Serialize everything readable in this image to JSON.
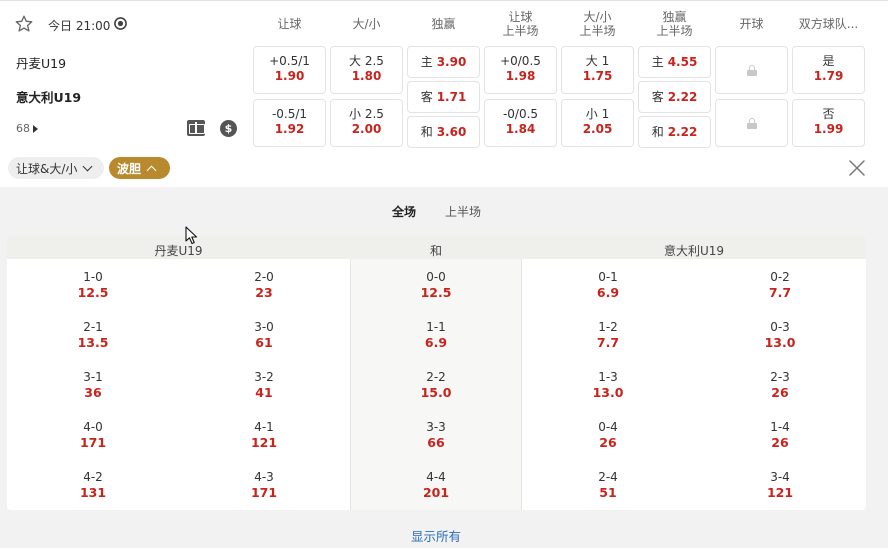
{
  "match": {
    "time_label": "今日 21:00",
    "home": "丹麦U19",
    "away": "意大利U19",
    "more_count": "68"
  },
  "columns": [
    {
      "h1": "让球",
      "h2": ""
    },
    {
      "h1": "大/小",
      "h2": ""
    },
    {
      "h1": "独赢",
      "h2": ""
    },
    {
      "h1": "让球",
      "h2": "上半场"
    },
    {
      "h1": "大/小",
      "h2": "上半场"
    },
    {
      "h1": "独赢",
      "h2": "上半场"
    },
    {
      "h1": "开球",
      "h2": ""
    },
    {
      "h1": "双方球队...",
      "h2": ""
    }
  ],
  "markets": {
    "handicap": [
      {
        "label": "+0.5/1",
        "odds": "1.90"
      },
      {
        "label": "-0.5/1",
        "odds": "1.92"
      }
    ],
    "over_under": [
      {
        "label": "大 2.5",
        "odds": "1.80"
      },
      {
        "label": "小 2.5",
        "odds": "2.00"
      }
    ],
    "win": [
      {
        "label": "主",
        "odds": "3.90"
      },
      {
        "label": "客",
        "odds": "1.71"
      },
      {
        "label": "和",
        "odds": "3.60"
      }
    ],
    "handicap_1h": [
      {
        "label": "+0/0.5",
        "odds": "1.98"
      },
      {
        "label": "-0/0.5",
        "odds": "1.84"
      }
    ],
    "over_under_1h": [
      {
        "label": "大 1",
        "odds": "1.75"
      },
      {
        "label": "小 1",
        "odds": "2.05"
      }
    ],
    "win_1h": [
      {
        "label": "主",
        "odds": "4.55"
      },
      {
        "label": "客",
        "odds": "2.22"
      },
      {
        "label": "和",
        "odds": "2.22"
      }
    ],
    "btts": [
      {
        "label": "是",
        "odds": "1.79"
      },
      {
        "label": "否",
        "odds": "1.99"
      }
    ]
  },
  "chips": {
    "filter": "让球&大/小",
    "active": "波胆"
  },
  "subtabs": [
    "全场",
    "上半场"
  ],
  "correct_score": {
    "headers": {
      "home": "丹麦U19",
      "draw": "和",
      "away": "意大利U19"
    },
    "home_a": [
      {
        "score": "1-0",
        "odds": "12.5"
      },
      {
        "score": "2-1",
        "odds": "13.5"
      },
      {
        "score": "3-1",
        "odds": "36"
      },
      {
        "score": "4-0",
        "odds": "171"
      },
      {
        "score": "4-2",
        "odds": "131"
      }
    ],
    "home_b": [
      {
        "score": "2-0",
        "odds": "23"
      },
      {
        "score": "3-0",
        "odds": "61"
      },
      {
        "score": "3-2",
        "odds": "41"
      },
      {
        "score": "4-1",
        "odds": "121"
      },
      {
        "score": "4-3",
        "odds": "171"
      }
    ],
    "draw": [
      {
        "score": "0-0",
        "odds": "12.5"
      },
      {
        "score": "1-1",
        "odds": "6.9"
      },
      {
        "score": "2-2",
        "odds": "15.0"
      },
      {
        "score": "3-3",
        "odds": "66"
      },
      {
        "score": "4-4",
        "odds": "201"
      }
    ],
    "away_a": [
      {
        "score": "0-1",
        "odds": "6.9"
      },
      {
        "score": "1-2",
        "odds": "7.7"
      },
      {
        "score": "1-3",
        "odds": "13.0"
      },
      {
        "score": "0-4",
        "odds": "26"
      },
      {
        "score": "2-4",
        "odds": "51"
      }
    ],
    "away_b": [
      {
        "score": "0-2",
        "odds": "7.7"
      },
      {
        "score": "0-3",
        "odds": "13.0"
      },
      {
        "score": "2-3",
        "odds": "26"
      },
      {
        "score": "1-4",
        "odds": "26"
      },
      {
        "score": "3-4",
        "odds": "121"
      }
    ]
  },
  "show_all": "显示所有",
  "icons": {
    "favorite": "star-icon",
    "time": "clock-icon",
    "stats": "pitch-icon",
    "cashout": "cash-icon",
    "locked": "lock-icon",
    "close": "close-icon",
    "pointer": "cursor-icon"
  },
  "colors": {
    "odds": "#c8231c",
    "accent_gold": "#b8892d",
    "link": "#2a6ebb"
  }
}
